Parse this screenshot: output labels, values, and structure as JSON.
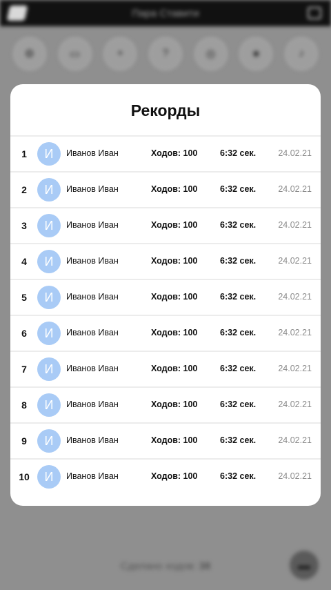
{
  "background": {
    "app_title": "Пара Ставити",
    "tool_icons": [
      "settings-icon",
      "cards-icon",
      "plus-icon",
      "help-icon",
      "target-icon",
      "star-icon",
      "music-icon"
    ],
    "tool_glyphs": [
      "⚙",
      "▭",
      "+",
      "?",
      "◎",
      "★",
      "♪"
    ],
    "moves_label": "Сделано ходов:",
    "moves_value": "38"
  },
  "modal": {
    "title": "Рекорды",
    "records": [
      {
        "rank": "1",
        "initial": "И",
        "name": "Иванов Иван",
        "moves": "Ходов: 100",
        "time": "6:32 сек.",
        "date": "24.02.21"
      },
      {
        "rank": "2",
        "initial": "И",
        "name": "Иванов Иван",
        "moves": "Ходов: 100",
        "time": "6:32 сек.",
        "date": "24.02.21"
      },
      {
        "rank": "3",
        "initial": "И",
        "name": "Иванов Иван",
        "moves": "Ходов: 100",
        "time": "6:32 сек.",
        "date": "24.02.21"
      },
      {
        "rank": "4",
        "initial": "И",
        "name": "Иванов Иван",
        "moves": "Ходов: 100",
        "time": "6:32 сек.",
        "date": "24.02.21"
      },
      {
        "rank": "5",
        "initial": "И",
        "name": "Иванов Иван",
        "moves": "Ходов: 100",
        "time": "6:32 сек.",
        "date": "24.02.21"
      },
      {
        "rank": "6",
        "initial": "И",
        "name": "Иванов Иван",
        "moves": "Ходов: 100",
        "time": "6:32 сек.",
        "date": "24.02.21"
      },
      {
        "rank": "7",
        "initial": "И",
        "name": "Иванов Иван",
        "moves": "Ходов: 100",
        "time": "6:32 сек.",
        "date": "24.02.21"
      },
      {
        "rank": "8",
        "initial": "И",
        "name": "Иванов Иван",
        "moves": "Ходов: 100",
        "time": "6:32 сек.",
        "date": "24.02.21"
      },
      {
        "rank": "9",
        "initial": "И",
        "name": "Иванов Иван",
        "moves": "Ходов: 100",
        "time": "6:32 сек.",
        "date": "24.02.21"
      },
      {
        "rank": "10",
        "initial": "И",
        "name": "Иванов Иван",
        "moves": "Ходов: 100",
        "time": "6:32 сек.",
        "date": "24.02.21"
      }
    ]
  },
  "colors": {
    "avatar_bg": "#a9cbf6",
    "date_text": "#8a8a8a",
    "overlay_bg": "#8f8f8f"
  }
}
